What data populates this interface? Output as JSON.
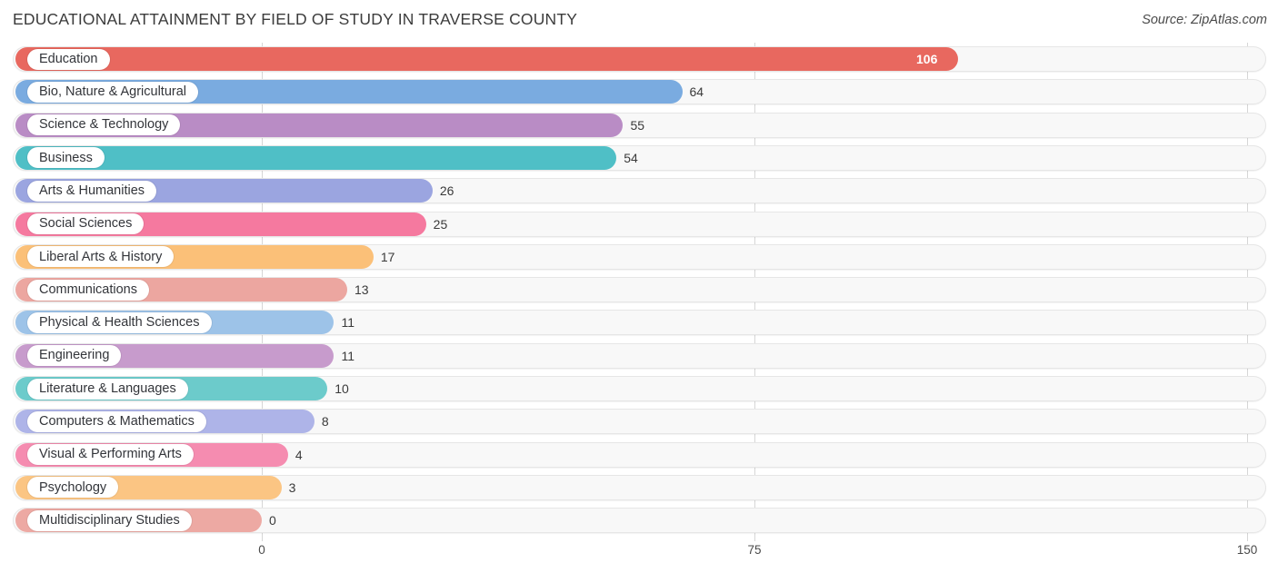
{
  "header": {
    "title": "EDUCATIONAL ATTAINMENT BY FIELD OF STUDY IN TRAVERSE COUNTY",
    "source": "Source: ZipAtlas.com"
  },
  "chart_data": {
    "type": "bar",
    "orientation": "horizontal",
    "title": "EDUCATIONAL ATTAINMENT BY FIELD OF STUDY IN TRAVERSE COUNTY",
    "xlabel": "",
    "ylabel": "",
    "xlim": [
      0,
      150
    ],
    "ticks": [
      "0",
      "75",
      "150"
    ],
    "tick_values": [
      0,
      75,
      150
    ],
    "grid": true,
    "legend": "none",
    "categories": [
      "Education",
      "Bio, Nature & Agricultural",
      "Science & Technology",
      "Business",
      "Arts & Humanities",
      "Social Sciences",
      "Liberal Arts & History",
      "Communications",
      "Physical & Health Sciences",
      "Engineering",
      "Literature & Languages",
      "Computers & Mathematics",
      "Visual & Performing Arts",
      "Psychology",
      "Multidisciplinary Studies"
    ],
    "values": [
      106,
      64,
      55,
      54,
      26,
      25,
      17,
      13,
      11,
      11,
      10,
      8,
      4,
      3,
      0
    ],
    "value_labels": [
      "106",
      "64",
      "55",
      "54",
      "26",
      "25",
      "17",
      "13",
      "11",
      "11",
      "10",
      "8",
      "4",
      "3",
      "0"
    ],
    "colors": [
      "#e8685f",
      "#7aabe0",
      "#b98cc5",
      "#4fbfc6",
      "#9ba5e0",
      "#f5799f",
      "#fbc078",
      "#eca6a0",
      "#9dc3e8",
      "#c79bcc",
      "#6ccbcb",
      "#aeb4e8",
      "#f58cb0",
      "#fbc583",
      "#eda9a3"
    ]
  }
}
